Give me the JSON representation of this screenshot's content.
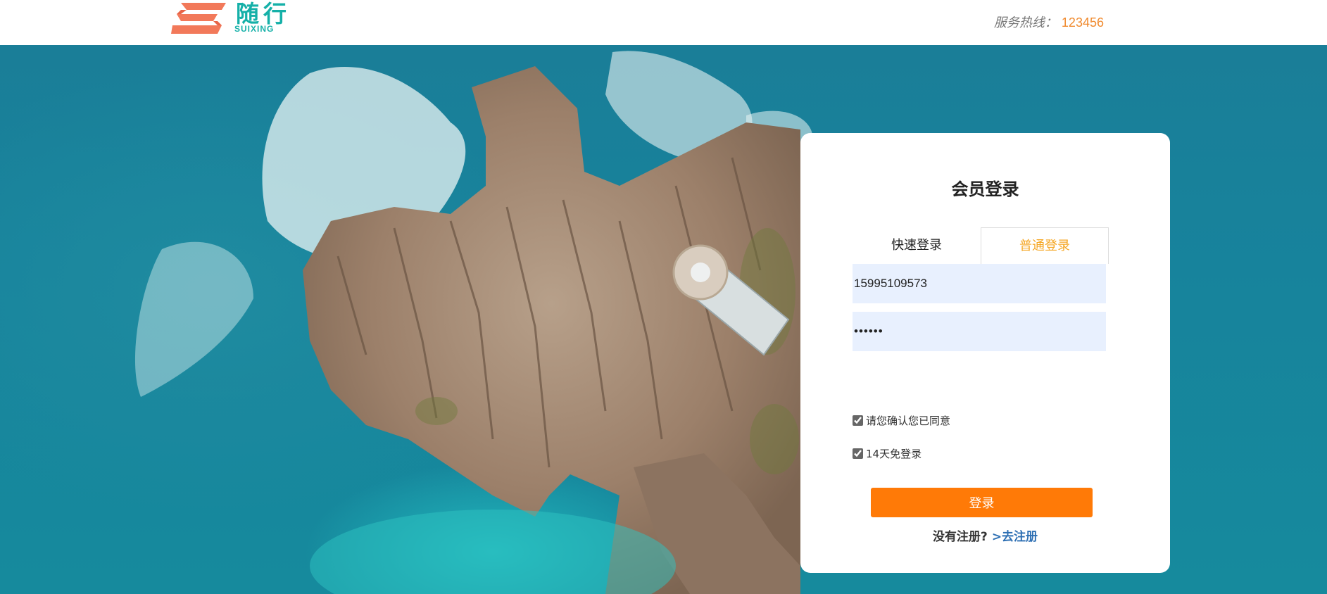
{
  "header": {
    "logo_cn": "随行",
    "logo_en": "SUIXING",
    "hotline_label": "服务热线：",
    "hotline_number": "123456"
  },
  "login": {
    "title": "会员登录",
    "tabs": [
      {
        "label": "快速登录",
        "active": false
      },
      {
        "label": "普通登录",
        "active": true
      }
    ],
    "phone_value": "15995109573",
    "password_value": "123456",
    "agree_label": "请您确认您已同意",
    "remember_label": "14天免登录",
    "submit_label": "登录",
    "register_question": "没有注册?",
    "register_link": ">去注册"
  },
  "colors": {
    "accent": "#ff7a07",
    "brand": "#15b0a8",
    "tab_active": "#f5a623",
    "link": "#2d6fb3"
  }
}
